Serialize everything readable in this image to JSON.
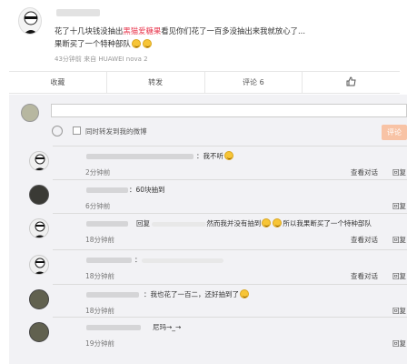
{
  "post": {
    "text_pre": "花了十几块钱没抽出",
    "text_highlight": "黑猫爱糖果",
    "text_post": "看见你们花了一百多没抽出来我就放心了...",
    "text_line2": "果断买了一个特种部队",
    "meta": "43分钟前 来自 HUAWEI nova 2"
  },
  "actions": {
    "collect": "收藏",
    "repost": "转发",
    "comment": "评论 6",
    "like_icon": "thumbs-up-icon"
  },
  "composer": {
    "placeholder": "",
    "sync_label": "同时转发到我的微博",
    "submit_label": "评论"
  },
  "comments": [
    {
      "text": "：我不听",
      "time": "2分钟前",
      "view": "查看对话",
      "reply": "回复"
    },
    {
      "text": "：60块抽到",
      "time": "6分钟前",
      "view": "",
      "reply": "回复"
    },
    {
      "text": "回复",
      "text2": "然而我并没有抽到",
      "text3": "所以我果断买了一个特种部队",
      "time": "18分钟前",
      "view": "查看对话",
      "reply": "回复"
    },
    {
      "text": "：",
      "time": "18分钟前",
      "view": "查看对话",
      "reply": "回复"
    },
    {
      "text": "：我也花了一百二，还好抽到了",
      "time": "18分钟前",
      "view": "",
      "reply": "回复"
    },
    {
      "text": "尼玛→_→",
      "time": "19分钟前",
      "view": "",
      "reply": "回复"
    }
  ]
}
